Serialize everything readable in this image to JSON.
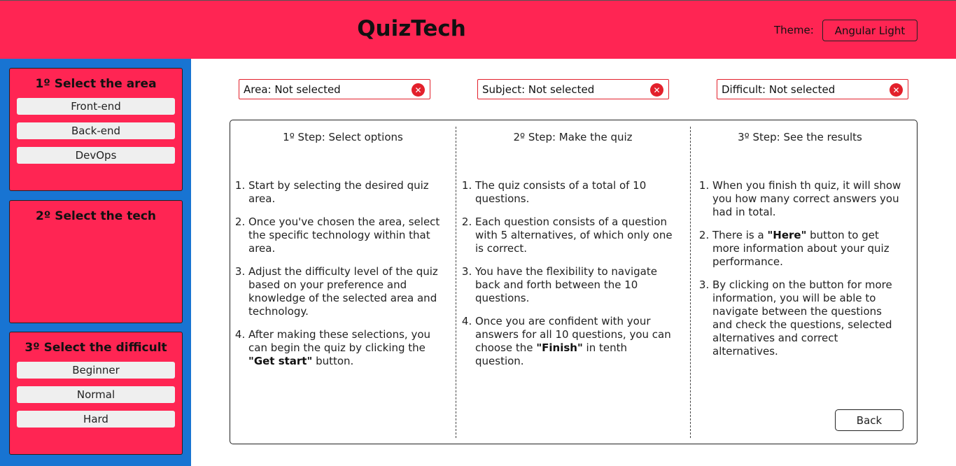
{
  "header": {
    "brand": "QuizTech",
    "theme_label": "Theme:",
    "theme_button": "Angular Light"
  },
  "sidebar": {
    "area": {
      "title": "1º Select the area",
      "options": [
        "Front-end",
        "Back-end",
        "DevOps"
      ]
    },
    "tech": {
      "title": "2º Select the tech",
      "options": []
    },
    "difficulty": {
      "title": "3º Select the difficult",
      "options": [
        "Beginner",
        "Normal",
        "Hard"
      ]
    }
  },
  "filters": {
    "area": "Area: Not selected",
    "subject": "Subject: Not selected",
    "difficult": "Difficult: Not selected"
  },
  "steps": {
    "step1": {
      "title": "1º Step: Select options",
      "items": [
        [
          "Start by selecting the desired quiz area."
        ],
        [
          "Once you've chosen the area, select the specific technology within that area."
        ],
        [
          "Adjust the difficulty level of the quiz based on your preference and knowledge of the selected area and technology."
        ],
        [
          "After making these selections, you can begin the quiz by clicking the ",
          "\"Get start\"",
          " button."
        ]
      ]
    },
    "step2": {
      "title": "2º Step: Make the quiz",
      "items": [
        [
          "The quiz consists of a total of 10 questions."
        ],
        [
          "Each question consists of a question with 5 alternatives, of which only one is correct."
        ],
        [
          "You have the flexibility to navigate back and forth between the 10 questions."
        ],
        [
          "Once you are confident with your answers for all 10 questions, you can choose the ",
          "\"Finish\"",
          " in tenth question."
        ]
      ]
    },
    "step3": {
      "title": "3º Step: See the results",
      "items": [
        [
          "When you finish th quiz, it will show you how many correct answers you had in total."
        ],
        [
          "There is a ",
          "\"Here\"",
          " button to get more information about your quiz performance."
        ],
        [
          "By clicking on the button for more information, you will be able to navigate between the questions and check the questions, selected alternatives and correct alternatives."
        ]
      ]
    }
  },
  "back_button": "Back",
  "icons": {
    "close": "close-icon"
  },
  "colors": {
    "primary": "#ff2553",
    "sidebar": "#1874d2",
    "danger": "#e3202b"
  }
}
